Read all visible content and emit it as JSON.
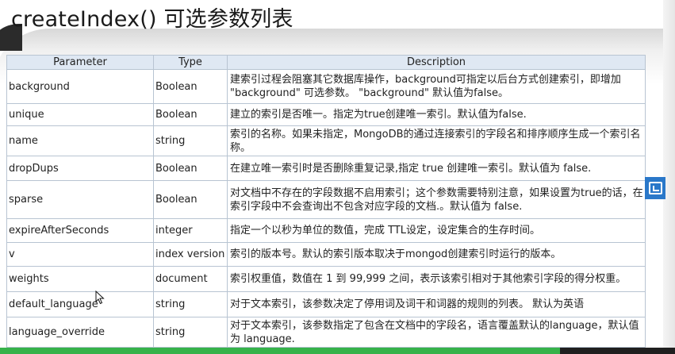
{
  "title": "createIndex() 可选参数列表",
  "table": {
    "headers": [
      "Parameter",
      "Type",
      "Description"
    ],
    "rows": [
      {
        "parameter": "background",
        "type": "Boolean",
        "description": "建索引过程会阻塞其它数据库操作，background可指定以后台方式创建索引，即增加 \"background\" 可选参数。 \"background\" 默认值为false。"
      },
      {
        "parameter": "unique",
        "type": "Boolean",
        "description": "建立的索引是否唯一。指定为true创建唯一索引。默认值为false."
      },
      {
        "parameter": "name",
        "type": "string",
        "description": "索引的名称。如果未指定，MongoDB的通过连接索引的字段名和排序顺序生成一个索引名称。"
      },
      {
        "parameter": "dropDups",
        "type": "Boolean",
        "description": "在建立唯一索引时是否删除重复记录,指定 true 创建唯一索引。默认值为 false."
      },
      {
        "parameter": "sparse",
        "type": "Boolean",
        "description": "对文档中不存在的字段数据不启用索引；这个参数需要特别注意，如果设置为true的话，在索引字段中不会查询出不包含对应字段的文档.。默认值为 false."
      },
      {
        "parameter": "expireAfterSeconds",
        "type": "integer",
        "description": "指定一个以秒为单位的数值，完成 TTL设定，设定集合的生存时间。"
      },
      {
        "parameter": "v",
        "type": "index version",
        "description": "索引的版本号。默认的索引版本取决于mongod创建索引时运行的版本。"
      },
      {
        "parameter": "weights",
        "type": "document",
        "description": "索引权重值，数值在 1 到 99,999 之间，表示该索引相对于其他索引字段的得分权重。"
      },
      {
        "parameter": "default_language",
        "type": "string",
        "description": "对于文本索引，该参数决定了停用词及词干和词器的规则的列表。 默认为英语"
      },
      {
        "parameter": "language_override",
        "type": "string",
        "description": "对于文本索引，该参数指定了包含在文档中的字段名，语言覆盖默认的language，默认值为 language."
      }
    ]
  },
  "side_button": {
    "icon": "screen-capture-icon",
    "color": "#2a78c9"
  },
  "progress": {
    "fraction": 0.83,
    "color": "#36b24a"
  }
}
